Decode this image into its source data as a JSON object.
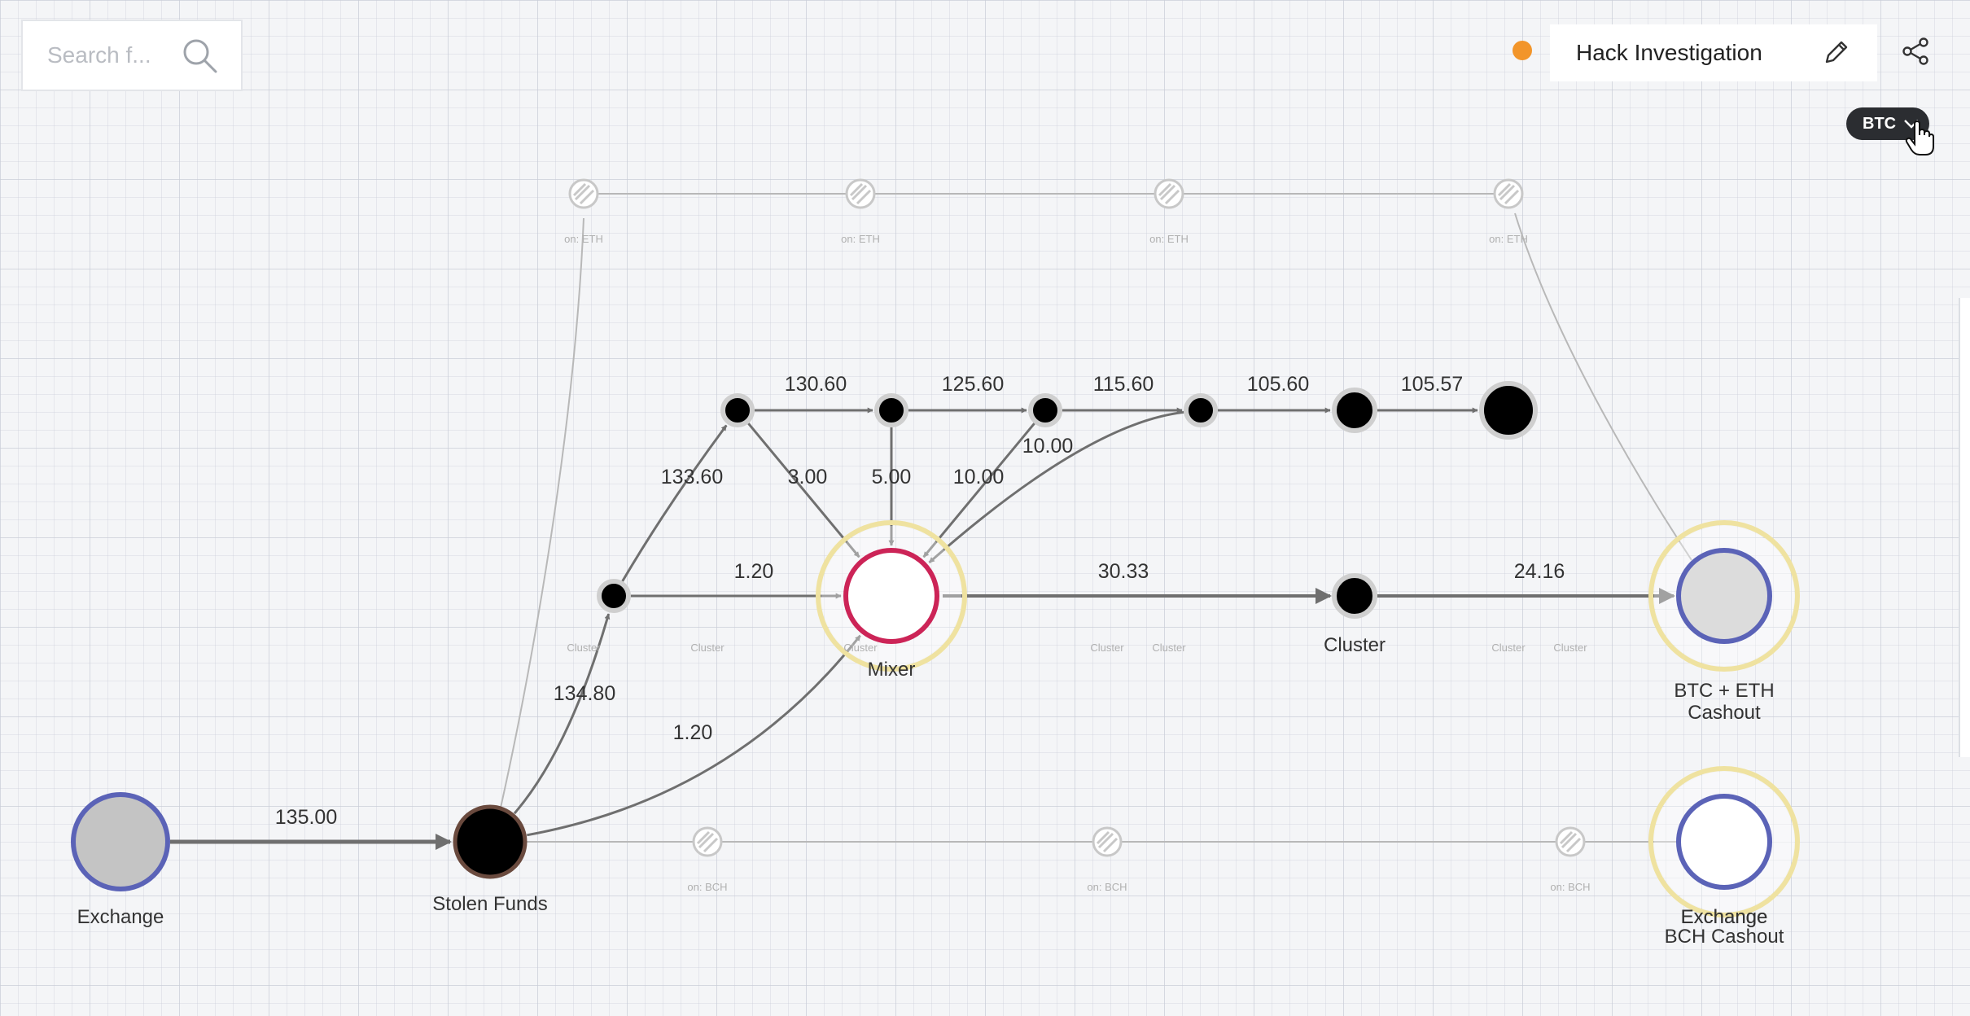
{
  "search": {
    "placeholder": "Search f..."
  },
  "header": {
    "title": "Hack Investigation",
    "status_color": "#f2952a",
    "edit_icon": "pencil-icon",
    "share_icon": "share-icon"
  },
  "currency_selector": {
    "value": "BTC",
    "icon": "chevron-down-icon"
  },
  "colors": {
    "edge": "#6f6f6f",
    "faded_edge": "#b8b8b8",
    "exchange_ring": "#5b63b7",
    "mixer_ring": "#cc2457",
    "halo": "#efe2a0",
    "stolen_ring": "#6a4a3e"
  },
  "graph": {
    "nodes": [
      {
        "id": "exchange",
        "label": "Exchange"
      },
      {
        "id": "stolen",
        "label": "Stolen Funds"
      },
      {
        "id": "mixer",
        "label": "Mixer"
      },
      {
        "id": "cluster",
        "label": "Cluster"
      },
      {
        "id": "btc_eth_cashout",
        "label": [
          "BTC + ETH",
          "Cashout",
          "Exchange"
        ]
      },
      {
        "id": "bch_cashout",
        "label": [
          "BCH Cashout",
          "Exchange"
        ]
      },
      {
        "id": "h1",
        "label": ""
      },
      {
        "id": "t1",
        "label": ""
      },
      {
        "id": "t2",
        "label": ""
      },
      {
        "id": "t3",
        "label": ""
      },
      {
        "id": "t4",
        "label": ""
      },
      {
        "id": "t5",
        "label": ""
      },
      {
        "id": "t6",
        "label": ""
      },
      {
        "id": "eth1",
        "label": [
          "Cluster",
          "on: ETH"
        ]
      },
      {
        "id": "eth2",
        "label": [
          "Cluster",
          "on: ETH"
        ]
      },
      {
        "id": "eth3",
        "label": [
          "Cluster",
          "on: ETH"
        ]
      },
      {
        "id": "eth4",
        "label": [
          "Cluster",
          "on: ETH"
        ]
      },
      {
        "id": "bch1",
        "label": [
          "Cluster",
          "on: BCH"
        ]
      },
      {
        "id": "bch2",
        "label": [
          "Cluster",
          "on: BCH"
        ]
      },
      {
        "id": "bch3",
        "label": [
          "Cluster",
          "on: BCH"
        ]
      }
    ],
    "edges": [
      {
        "from": "exchange",
        "to": "stolen",
        "value": "135.00"
      },
      {
        "from": "stolen",
        "to": "h1",
        "value": "134.80"
      },
      {
        "from": "stolen",
        "to": "mixer",
        "value": "1.20"
      },
      {
        "from": "h1",
        "to": "mixer",
        "value": "1.20"
      },
      {
        "from": "h1",
        "to": "t1",
        "value": "133.60"
      },
      {
        "from": "t1",
        "to": "t2",
        "value": "130.60"
      },
      {
        "from": "t2",
        "to": "t3",
        "value": "125.60"
      },
      {
        "from": "t3",
        "to": "t4",
        "value": "115.60"
      },
      {
        "from": "t4",
        "to": "t5",
        "value": "105.60"
      },
      {
        "from": "t5",
        "to": "t6",
        "value": "105.57"
      },
      {
        "from": "t1",
        "to": "mixer",
        "value": "3.00"
      },
      {
        "from": "t2",
        "to": "mixer",
        "value": "5.00"
      },
      {
        "from": "t3",
        "to": "mixer",
        "value": "10.00"
      },
      {
        "from": "t4",
        "to": "mixer",
        "value": "10.00"
      },
      {
        "from": "mixer",
        "to": "cluster",
        "value": "30.33"
      },
      {
        "from": "cluster",
        "to": "btc_eth_cashout",
        "value": "24.16"
      }
    ]
  }
}
